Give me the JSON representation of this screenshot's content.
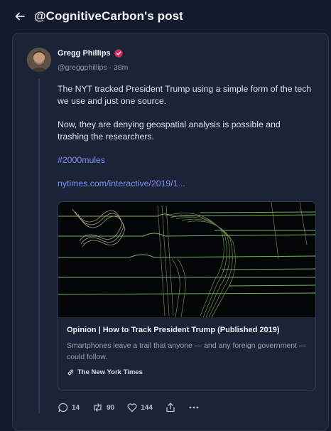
{
  "header": {
    "title": "@CognitiveCarbon's post"
  },
  "post": {
    "author_name": "Gregg Phillips",
    "handle_time": "@greggphillips · 38m",
    "paragraphs": [
      "The NYT tracked President Trump using a simple form of the tech we use and just one source.",
      "Now, they are denying geospatial analysis is possible and trashing the researchers."
    ],
    "hashtag": "#2000mules",
    "link_text": "nytimes.com/interactive/2019/1...",
    "link_card": {
      "title": "Opinion | How to Track President Trump (Published 2019)",
      "description": "Smartphones leave a trail that anyone — and any foreign government — could follow.",
      "source": "The New York Times"
    },
    "stats": {
      "replies": "14",
      "reposts": "90",
      "likes": "144"
    }
  },
  "colors": {
    "background": "#131a2b",
    "card": "#1b2437",
    "accent": "#7f8ff0",
    "verified": "#e0245e"
  },
  "icons": [
    "back-arrow-icon",
    "verified-badge-icon",
    "link-icon",
    "reply-icon",
    "repost-icon",
    "like-icon",
    "share-icon",
    "more-icon"
  ]
}
